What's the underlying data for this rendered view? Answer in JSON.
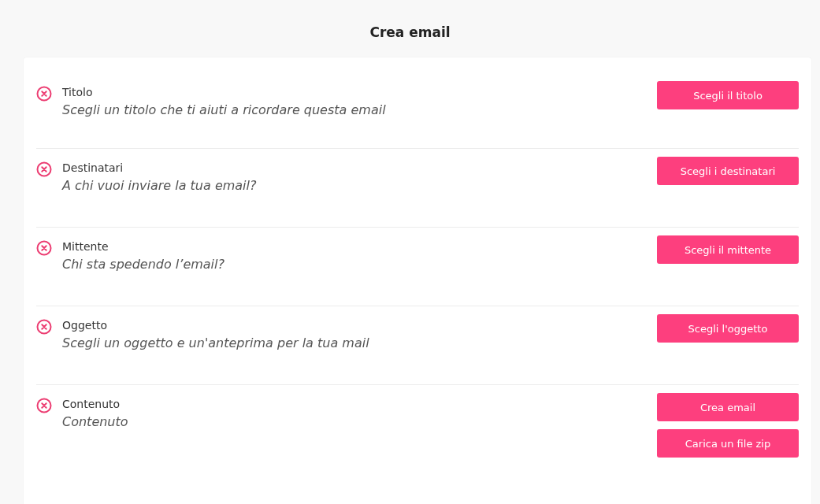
{
  "page_title": "Crea email",
  "sections": [
    {
      "label": "Titolo",
      "description": "Scegli un titolo che ti aiuti a ricordare questa email",
      "done": false,
      "buttons": [
        "Scegli il titolo"
      ]
    },
    {
      "label": "Destinatari",
      "description": "A chi vuoi inviare la tua email?",
      "done": false,
      "buttons": [
        "Scegli i destinatari"
      ]
    },
    {
      "label": "Mittente",
      "description": "Chi sta spedendo l’email?",
      "done": false,
      "buttons": [
        "Scegli il mittente"
      ]
    },
    {
      "label": "Oggetto",
      "description": "Scegli un oggetto e un'anteprima per la tua mail",
      "done": false,
      "buttons": [
        "Scegli l'oggetto"
      ]
    },
    {
      "label": "Contenuto",
      "description": "Contenuto",
      "done": false,
      "buttons": [
        "Crea email",
        "Carica un file zip"
      ]
    }
  ]
}
